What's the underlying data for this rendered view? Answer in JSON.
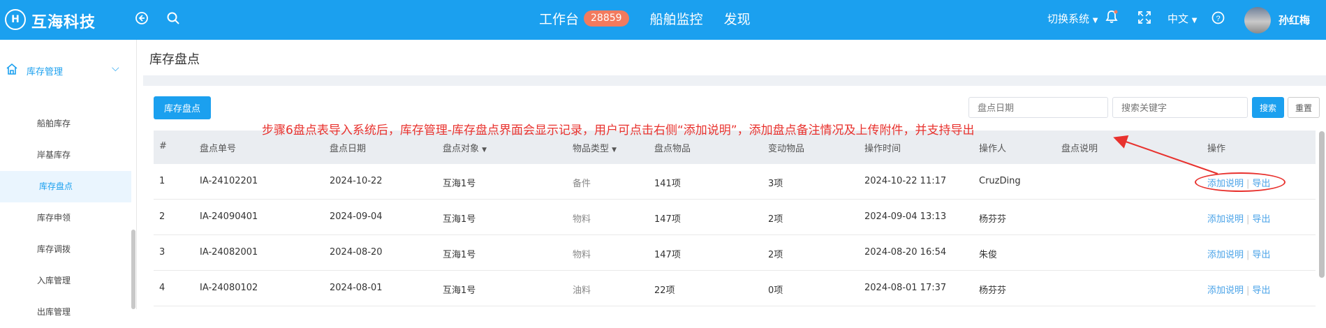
{
  "app": {
    "logo_glyph": "H",
    "name": "互海科技"
  },
  "topnav": {
    "workbench_label": "工作台",
    "workbench_badge": "28859",
    "monitor_label": "船舶监控",
    "discover_label": "发现"
  },
  "topright": {
    "switch_system_label": "切换系统",
    "language_label": "中文",
    "username": "孙红梅"
  },
  "icons": {
    "back": "circle-arrow-left-icon",
    "search": "search-icon",
    "bell": "bell-icon",
    "fullscreen": "fullscreen-icon",
    "help": "help-circle-icon"
  },
  "colors": {
    "brand": "#1ba0ef",
    "badge": "#f27a5e",
    "annotation": "#e8322e",
    "link": "#4aa3e8"
  },
  "sidebar": {
    "group_label": "库存管理",
    "items": [
      {
        "label": "船舶库存"
      },
      {
        "label": "岸基库存"
      },
      {
        "label": "库存盘点"
      },
      {
        "label": "库存申领"
      },
      {
        "label": "库存调拨"
      },
      {
        "label": "入库管理"
      },
      {
        "label": "出库管理"
      }
    ]
  },
  "page": {
    "title": "库存盘点"
  },
  "toolbar": {
    "add_button": "库存盘点",
    "date_placeholder": "盘点日期",
    "keyword_placeholder": "搜索关键字",
    "search_button": "搜索",
    "reset_button": "重置"
  },
  "table": {
    "headers": [
      "#",
      "盘点单号",
      "盘点日期",
      "盘点对象",
      "物品类型",
      "盘点物品",
      "变动物品",
      "操作时间",
      "操作人",
      "盘点说明",
      "操作"
    ],
    "sort_caret": "▼",
    "rows": [
      {
        "index": "1",
        "code": "IA-24102201",
        "date": "2024-10-22",
        "target": "互海1号",
        "type": "备件",
        "items": "141项",
        "changed": "3项",
        "op_time": "2024-10-22 11:17",
        "operator": "CruzDing",
        "note": ""
      },
      {
        "index": "2",
        "code": "IA-24090401",
        "date": "2024-09-04",
        "target": "互海1号",
        "type": "物料",
        "items": "147项",
        "changed": "2项",
        "op_time": "2024-09-04 13:13",
        "operator": "杨芬芬",
        "note": ""
      },
      {
        "index": "3",
        "code": "IA-24082001",
        "date": "2024-08-20",
        "target": "互海1号",
        "type": "物料",
        "items": "147项",
        "changed": "2项",
        "op_time": "2024-08-20 16:54",
        "operator": "朱俊",
        "note": ""
      },
      {
        "index": "4",
        "code": "IA-24080102",
        "date": "2024-08-01",
        "target": "互海1号",
        "type": "油料",
        "items": "22项",
        "changed": "0项",
        "op_time": "2024-08-01 17:37",
        "operator": "杨芬芬",
        "note": ""
      }
    ],
    "action_add_note": "添加说明",
    "action_sep": "|",
    "action_export": "导出"
  },
  "annotation": {
    "text": "步骤6盘点表导入系统后，库存管理-库存盘点界面会显示记录，用户可点击右侧“添加说明”，添加盘点备注情况及上传附件，并支持导出"
  }
}
